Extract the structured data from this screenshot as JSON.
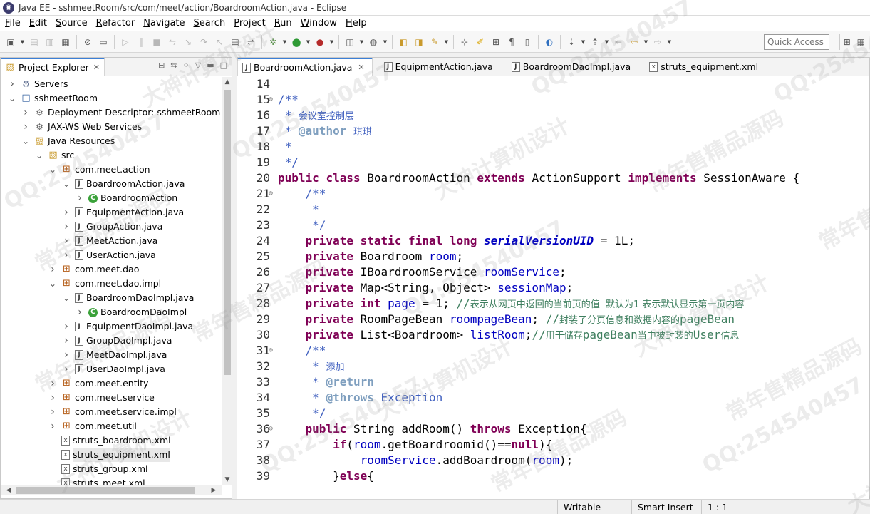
{
  "window": {
    "title": "Java EE - sshmeetRoom/src/com/meet/action/BoardroomAction.java - Eclipse"
  },
  "menubar": [
    {
      "u": "F",
      "rest": "ile"
    },
    {
      "u": "E",
      "rest": "dit"
    },
    {
      "u": "",
      "rest": "Source",
      "pre": "",
      "ulpos": "S"
    },
    {
      "u": "",
      "rest": "Refactor"
    },
    {
      "u": "",
      "rest": "Navigate"
    },
    {
      "u": "",
      "rest": "Search"
    },
    {
      "u": "",
      "rest": "Project"
    },
    {
      "u": "",
      "rest": "Run"
    },
    {
      "u": "",
      "rest": "Window"
    },
    {
      "u": "",
      "rest": "Help"
    }
  ],
  "menus": [
    "File",
    "Edit",
    "Source",
    "Refactor",
    "Navigate",
    "Search",
    "Project",
    "Run",
    "Window",
    "Help"
  ],
  "toolbar": {
    "quick_access_placeholder": "Quick Access"
  },
  "explorer": {
    "tab_label": "Project Explorer",
    "tree": [
      {
        "label": "Servers",
        "icon": "folder-icon",
        "indent": 0,
        "arrow": ">"
      },
      {
        "label": "sshmeetRoom",
        "icon": "project-icon",
        "indent": 0,
        "arrow": "v"
      },
      {
        "label": "Deployment Descriptor: sshmeetRoom",
        "icon": "deployment-descriptor-icon",
        "indent": 1,
        "arrow": ">"
      },
      {
        "label": "JAX-WS Web Services",
        "icon": "web-services-icon",
        "indent": 1,
        "arrow": ">"
      },
      {
        "label": "Java Resources",
        "icon": "java-resources-icon",
        "indent": 1,
        "arrow": "v"
      },
      {
        "label": "src",
        "icon": "source-folder-icon",
        "indent": 2,
        "arrow": "v"
      },
      {
        "label": "com.meet.action",
        "icon": "package-icon",
        "indent": 3,
        "arrow": "v"
      },
      {
        "label": "BoardroomAction.java",
        "icon": "java-file-icon",
        "indent": 4,
        "arrow": "v"
      },
      {
        "label": "BoardroomAction",
        "icon": "class-icon",
        "indent": 5,
        "arrow": ">"
      },
      {
        "label": "EquipmentAction.java",
        "icon": "java-file-icon",
        "indent": 4,
        "arrow": ">"
      },
      {
        "label": "GroupAction.java",
        "icon": "java-file-icon",
        "indent": 4,
        "arrow": ">"
      },
      {
        "label": "MeetAction.java",
        "icon": "java-file-icon",
        "indent": 4,
        "arrow": ">"
      },
      {
        "label": "UserAction.java",
        "icon": "java-file-icon",
        "indent": 4,
        "arrow": ">"
      },
      {
        "label": "com.meet.dao",
        "icon": "package-icon",
        "indent": 3,
        "arrow": ">"
      },
      {
        "label": "com.meet.dao.impl",
        "icon": "package-icon",
        "indent": 3,
        "arrow": "v"
      },
      {
        "label": "BoardroomDaoImpl.java",
        "icon": "java-file-icon",
        "indent": 4,
        "arrow": "v"
      },
      {
        "label": "BoardroomDaoImpl",
        "icon": "class-icon",
        "indent": 5,
        "arrow": ">"
      },
      {
        "label": "EquipmentDaoImpl.java",
        "icon": "java-file-icon",
        "indent": 4,
        "arrow": ">"
      },
      {
        "label": "GroupDaoImpl.java",
        "icon": "java-file-icon",
        "indent": 4,
        "arrow": ">"
      },
      {
        "label": "MeetDaoImpl.java",
        "icon": "java-file-icon",
        "indent": 4,
        "arrow": ">"
      },
      {
        "label": "UserDaoImpl.java",
        "icon": "java-file-icon",
        "indent": 4,
        "arrow": ">"
      },
      {
        "label": "com.meet.entity",
        "icon": "package-icon",
        "indent": 3,
        "arrow": ">"
      },
      {
        "label": "com.meet.service",
        "icon": "package-icon",
        "indent": 3,
        "arrow": ">"
      },
      {
        "label": "com.meet.service.impl",
        "icon": "package-icon",
        "indent": 3,
        "arrow": ">"
      },
      {
        "label": "com.meet.util",
        "icon": "package-icon",
        "indent": 3,
        "arrow": ">"
      },
      {
        "label": "struts_boardroom.xml",
        "icon": "xml-file-icon",
        "indent": 3,
        "arrow": ""
      },
      {
        "label": "struts_equipment.xml",
        "icon": "xml-file-icon",
        "indent": 3,
        "arrow": "",
        "selected": true
      },
      {
        "label": "struts_group.xml",
        "icon": "xml-file-icon",
        "indent": 3,
        "arrow": ""
      },
      {
        "label": "struts_meet.xml",
        "icon": "xml-file-icon",
        "indent": 3,
        "arrow": ""
      }
    ]
  },
  "editor": {
    "tabs": [
      {
        "label": "BoardroomAction.java",
        "active": true,
        "icon": "java-file-icon"
      },
      {
        "label": "EquipmentAction.java",
        "active": false,
        "icon": "java-file-icon"
      },
      {
        "label": "BoardroomDaoImpl.java",
        "active": false,
        "icon": "java-file-icon"
      },
      {
        "label": "struts_equipment.xml",
        "active": false,
        "icon": "xml-file-icon"
      }
    ],
    "lines": [
      {
        "n": "14",
        "fold": "",
        "tokens": []
      },
      {
        "n": "15",
        "fold": "⊖",
        "tokens": [
          [
            "jd",
            "/**"
          ]
        ]
      },
      {
        "n": "16",
        "fold": "",
        "tokens": [
          [
            "jd",
            " * "
          ],
          [
            "jdzh",
            "会议室控制层"
          ]
        ]
      },
      {
        "n": "17",
        "fold": "",
        "tokens": [
          [
            "jd",
            " * "
          ],
          [
            "jt",
            "@author"
          ],
          [
            "jd",
            " "
          ],
          [
            "jdzh",
            "琪琪"
          ]
        ]
      },
      {
        "n": "18",
        "fold": "",
        "tokens": [
          [
            "jd",
            " *"
          ]
        ]
      },
      {
        "n": "19",
        "fold": "",
        "tokens": [
          [
            "jd",
            " */"
          ]
        ]
      },
      {
        "n": "20",
        "fold": "",
        "tokens": [
          [
            "kw",
            "public"
          ],
          [
            "",
            " "
          ],
          [
            "kw",
            "class"
          ],
          [
            "",
            " BoardroomAction "
          ],
          [
            "kw",
            "extends"
          ],
          [
            "",
            " ActionSupport "
          ],
          [
            "kw",
            "implements"
          ],
          [
            "",
            " SessionAware {"
          ]
        ]
      },
      {
        "n": "21",
        "fold": "⊖",
        "tokens": [
          [
            "",
            "    "
          ],
          [
            "jd",
            "/**"
          ]
        ]
      },
      {
        "n": "22",
        "fold": "",
        "tokens": [
          [
            "",
            "    "
          ],
          [
            "jd",
            " *"
          ]
        ]
      },
      {
        "n": "23",
        "fold": "",
        "tokens": [
          [
            "",
            "    "
          ],
          [
            "jd",
            " */"
          ]
        ]
      },
      {
        "n": "24",
        "fold": "",
        "tokens": [
          [
            "",
            "    "
          ],
          [
            "kw",
            "private"
          ],
          [
            "",
            " "
          ],
          [
            "kw",
            "static"
          ],
          [
            "",
            " "
          ],
          [
            "kw",
            "final"
          ],
          [
            "",
            " "
          ],
          [
            "kw",
            "long"
          ],
          [
            "",
            " "
          ],
          [
            "sf",
            "serialVersionUID"
          ],
          [
            "",
            " = 1L;"
          ]
        ]
      },
      {
        "n": "25",
        "fold": "",
        "tokens": [
          [
            "",
            "    "
          ],
          [
            "kw",
            "private"
          ],
          [
            "",
            " Boardroom "
          ],
          [
            "fd",
            "room"
          ],
          [
            "",
            ";"
          ]
        ]
      },
      {
        "n": "26",
        "fold": "",
        "tokens": [
          [
            "",
            "    "
          ],
          [
            "kw",
            "private"
          ],
          [
            "",
            " IBoardroomService "
          ],
          [
            "fd",
            "roomService"
          ],
          [
            "",
            ";"
          ]
        ]
      },
      {
        "n": "27",
        "fold": "",
        "tokens": [
          [
            "",
            "    "
          ],
          [
            "kw",
            "private"
          ],
          [
            "",
            " Map<String, Object> "
          ],
          [
            "fd",
            "sessionMap"
          ],
          [
            "",
            ";"
          ]
        ]
      },
      {
        "n": "28",
        "fold": "",
        "tokens": [
          [
            "",
            "    "
          ],
          [
            "kw",
            "private"
          ],
          [
            "",
            " "
          ],
          [
            "kw",
            "int"
          ],
          [
            "",
            " "
          ],
          [
            "fd",
            "page"
          ],
          [
            "",
            " = 1; "
          ],
          [
            "cm",
            "//"
          ],
          [
            "cmzh",
            "表示从网页中返回的当前页的值  默认为1 表示默认显示第一页内容"
          ]
        ]
      },
      {
        "n": "29",
        "fold": "",
        "tokens": [
          [
            "",
            "    "
          ],
          [
            "kw",
            "private"
          ],
          [
            "",
            " RoomPageBean "
          ],
          [
            "fd",
            "roompageBean"
          ],
          [
            "",
            "; "
          ],
          [
            "cm",
            "//"
          ],
          [
            "cmzh",
            "封装了分页信息和数据内容的"
          ],
          [
            "cm",
            "pageBean"
          ]
        ]
      },
      {
        "n": "30",
        "fold": "",
        "tokens": [
          [
            "",
            "    "
          ],
          [
            "kw",
            "private"
          ],
          [
            "",
            " List<Boardroom> "
          ],
          [
            "fd",
            "listRoom"
          ],
          [
            "",
            ";"
          ],
          [
            "cm",
            "//"
          ],
          [
            "cmzh",
            "用于储存"
          ],
          [
            "cm",
            "pageBean"
          ],
          [
            "cmzh",
            "当中被封装的"
          ],
          [
            "cm",
            "User"
          ],
          [
            "cmzh",
            "信息"
          ]
        ]
      },
      {
        "n": "31",
        "fold": "⊖",
        "tokens": [
          [
            "",
            "    "
          ],
          [
            "jd",
            "/**"
          ]
        ]
      },
      {
        "n": "32",
        "fold": "",
        "tokens": [
          [
            "",
            "    "
          ],
          [
            "jd",
            " * "
          ],
          [
            "jdzh",
            "添加"
          ]
        ]
      },
      {
        "n": "33",
        "fold": "",
        "tokens": [
          [
            "",
            "    "
          ],
          [
            "jd",
            " * "
          ],
          [
            "jt",
            "@return"
          ]
        ]
      },
      {
        "n": "34",
        "fold": "",
        "tokens": [
          [
            "",
            "    "
          ],
          [
            "jd",
            " * "
          ],
          [
            "jt",
            "@throws"
          ],
          [
            "jd",
            " Exception"
          ]
        ]
      },
      {
        "n": "35",
        "fold": "",
        "tokens": [
          [
            "",
            "    "
          ],
          [
            "jd",
            " */"
          ]
        ]
      },
      {
        "n": "36",
        "fold": "⊖",
        "tokens": [
          [
            "",
            "    "
          ],
          [
            "kw",
            "public"
          ],
          [
            "",
            " String addRoom() "
          ],
          [
            "kw",
            "throws"
          ],
          [
            "",
            " Exception{"
          ]
        ]
      },
      {
        "n": "37",
        "fold": "",
        "tokens": [
          [
            "",
            "        "
          ],
          [
            "kw",
            "if"
          ],
          [
            "",
            "("
          ],
          [
            "fd",
            "room"
          ],
          [
            "",
            ".getBoardroomid()=="
          ],
          [
            "kw",
            "null"
          ],
          [
            "",
            "){"
          ]
        ]
      },
      {
        "n": "38",
        "fold": "",
        "tokens": [
          [
            "",
            "            "
          ],
          [
            "fd",
            "roomService"
          ],
          [
            "",
            ".addBoardroom("
          ],
          [
            "fd",
            "room"
          ],
          [
            "",
            ");"
          ]
        ]
      },
      {
        "n": "39",
        "fold": "",
        "tokens": [
          [
            "",
            "        }"
          ],
          [
            "kw",
            "else"
          ],
          [
            "",
            "{"
          ]
        ]
      }
    ]
  },
  "status": {
    "writable": "Writable",
    "insert_mode": "Smart Insert",
    "position": "1 : 1"
  },
  "watermark": [
    "常年售精品源码",
    "QQ:254540457",
    "大神计算机设计"
  ]
}
